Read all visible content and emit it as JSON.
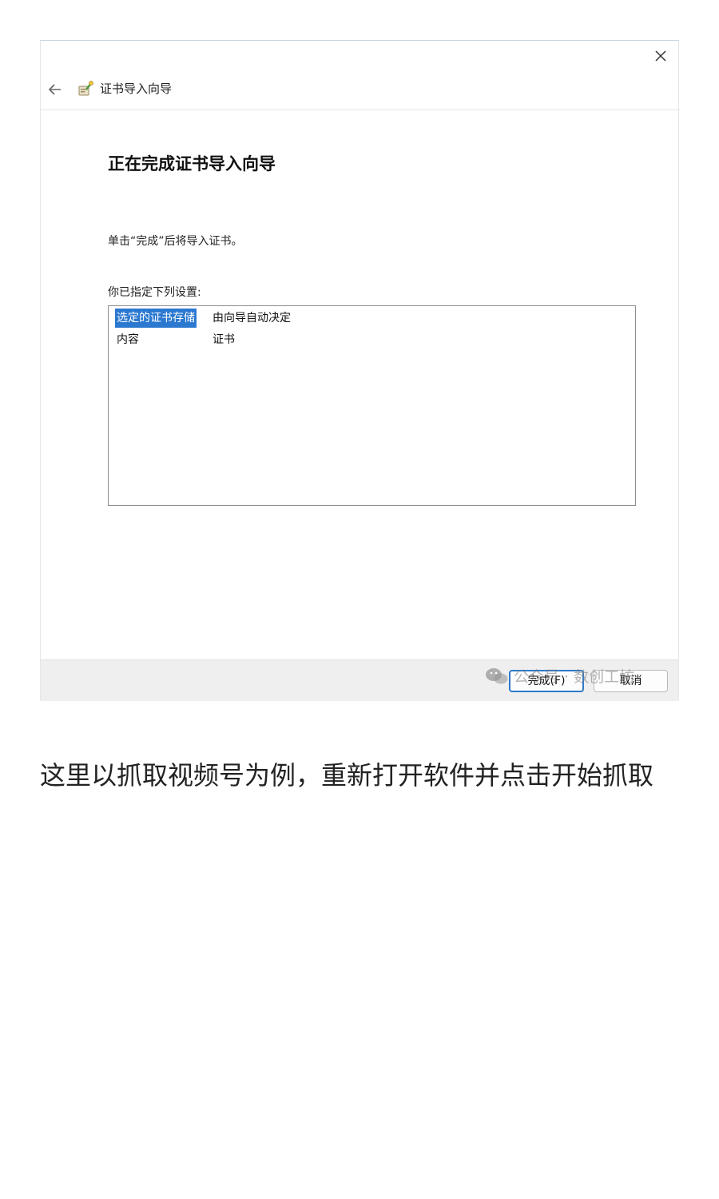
{
  "dialog": {
    "close_glyph": "✕",
    "back_glyph": "←",
    "wizard_title": "证书导入向导",
    "heading": "正在完成证书导入向导",
    "instruction": "单击“完成”后将导入证书。",
    "settings_label": "你已指定下列设置:",
    "settings": [
      {
        "key": "选定的证书存储",
        "value": "由向导自动决定",
        "selected": true
      },
      {
        "key": "内容",
        "value": "证书",
        "selected": false
      }
    ],
    "buttons": {
      "finish": "完成(F)",
      "cancel": "取消"
    },
    "accent_color": "#2b78d0"
  },
  "watermark": {
    "icon": "wechat-icon",
    "text": "公众号 · 数创工坊"
  },
  "article": {
    "paragraph": "这里以抓取视频号为例，重新打开软件并点击开始抓取"
  }
}
